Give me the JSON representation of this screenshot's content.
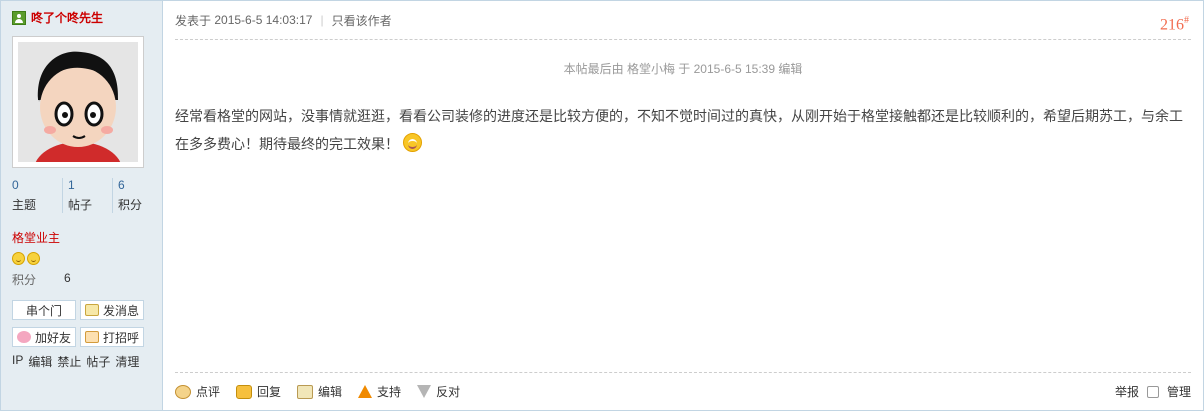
{
  "author": {
    "name": "咚了个咚先生"
  },
  "stats": [
    {
      "num": "0",
      "label": "主题"
    },
    {
      "num": "1",
      "label": "帖子"
    },
    {
      "num": "6",
      "label": "积分"
    }
  ],
  "group": "格堂业主",
  "points": {
    "label": "积分",
    "value": "6"
  },
  "actions": {
    "visit": "串个门",
    "message": "发消息",
    "add_friend": "加好友",
    "greet": "打招呼"
  },
  "admin": [
    "IP",
    "编辑",
    "禁止",
    "帖子",
    "清理"
  ],
  "post": {
    "posted_prefix": "发表于",
    "posted_time": "2015-6-5 14:03:17",
    "only_author": "只看该作者",
    "floor": "216",
    "floor_sup": "#",
    "edited_note": "本帖最后由 格堂小梅 于 2015-6-5 15:39 编辑",
    "content": "经常看格堂的网站，没事情就逛逛，看看公司装修的进度还是比较方便的，不知不觉时间过的真快，从刚开始于格堂接触都还是比较顺利的，希望后期苏工，与余工在多多费心！期待最终的完工效果！"
  },
  "footer": {
    "rate": "点评",
    "reply": "回复",
    "edit": "编辑",
    "support": "支持",
    "oppose": "反对",
    "report": "举报",
    "manage": "管理"
  },
  "colors": {
    "author": "#cc0000",
    "floor": "#f26c4f",
    "side_bg": "#e5edf2"
  }
}
